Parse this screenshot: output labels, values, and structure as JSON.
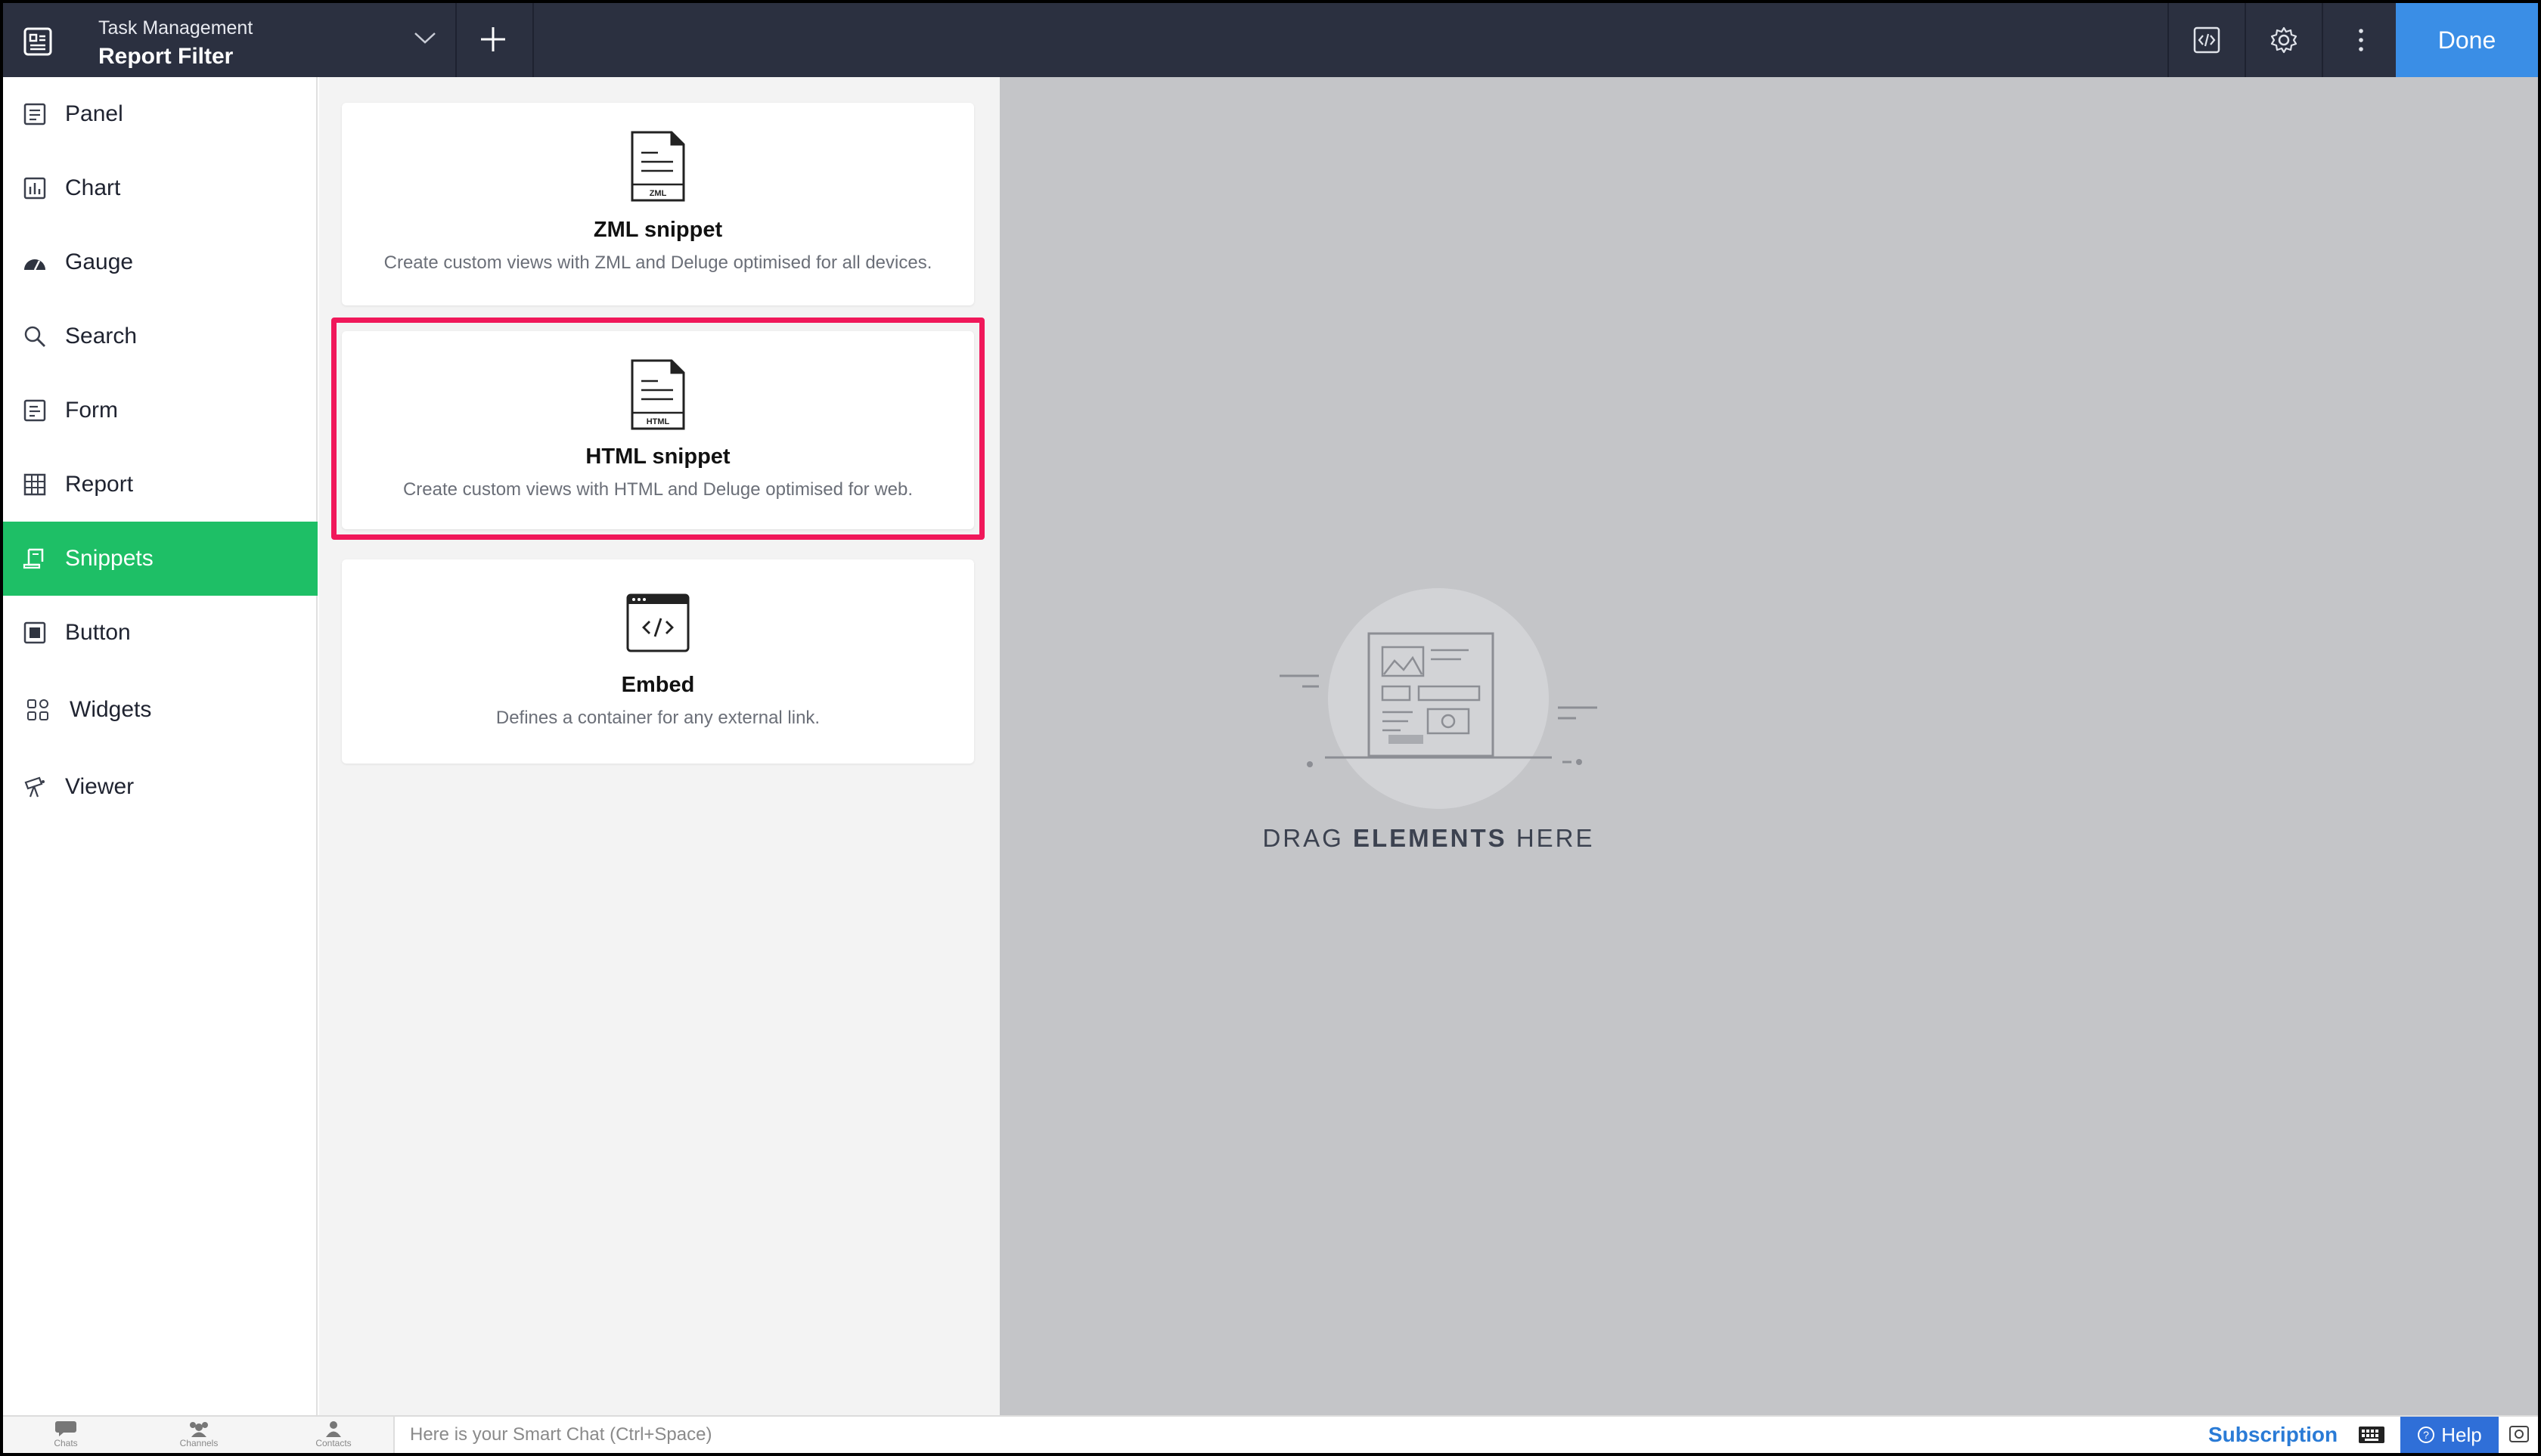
{
  "header": {
    "app_name": "Task Management",
    "page_name": "Report Filter",
    "done_label": "Done"
  },
  "sidebar": {
    "items": [
      {
        "label": "Panel",
        "icon": "panel-icon"
      },
      {
        "label": "Chart",
        "icon": "chart-icon"
      },
      {
        "label": "Gauge",
        "icon": "gauge-icon"
      },
      {
        "label": "Search",
        "icon": "search-icon"
      },
      {
        "label": "Form",
        "icon": "form-icon"
      },
      {
        "label": "Report",
        "icon": "report-icon"
      },
      {
        "label": "Snippets",
        "icon": "snippets-icon",
        "active": true
      },
      {
        "label": "Button",
        "icon": "button-icon"
      },
      {
        "label": "Widgets",
        "icon": "widgets-icon"
      },
      {
        "label": "Viewer",
        "icon": "viewer-icon"
      }
    ]
  },
  "snippets": {
    "cards": [
      {
        "title": "ZML snippet",
        "description": "Create custom views with ZML and Deluge optimised for all devices.",
        "icon_text": "ZML"
      },
      {
        "title": "HTML snippet",
        "description": "Create custom views with HTML and Deluge optimised for web.",
        "icon_text": "HTML",
        "highlighted": true
      },
      {
        "title": "Embed",
        "description": "Defines a container for any external link."
      }
    ]
  },
  "canvas": {
    "drag_prefix": "DRAG ",
    "drag_bold": "ELEMENTS",
    "drag_suffix": " HERE"
  },
  "bottombar": {
    "tabs": [
      "Chats",
      "Channels",
      "Contacts"
    ],
    "smart_chat_placeholder": "Here is your Smart Chat (Ctrl+Space)",
    "subscription_label": "Subscription",
    "help_label": "Help"
  },
  "colors": {
    "topbar": "#2b3040",
    "accent_blue": "#3a8ee6",
    "active_green": "#1ebf66",
    "highlight_red": "#f0185a",
    "canvas_gray": "#c4c5c8"
  }
}
